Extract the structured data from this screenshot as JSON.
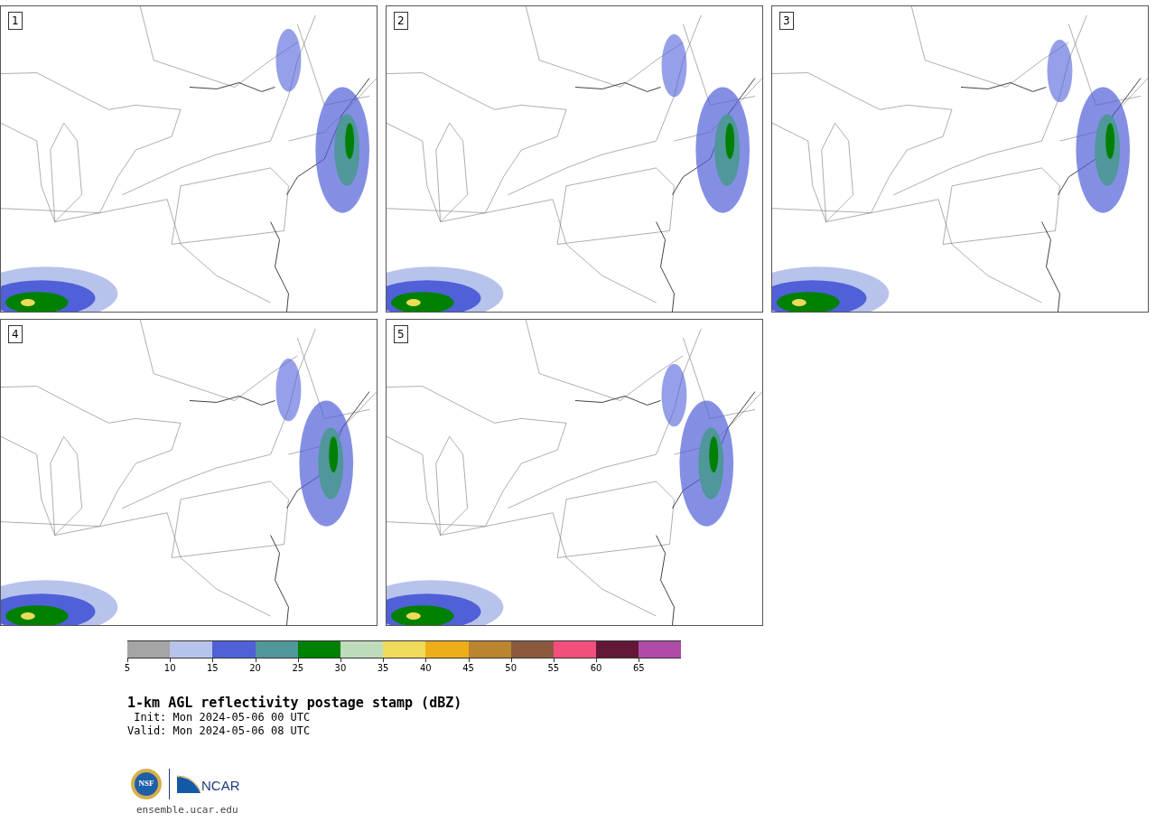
{
  "panels": [
    {
      "label": "1"
    },
    {
      "label": "2"
    },
    {
      "label": "3"
    },
    {
      "label": "4"
    },
    {
      "label": "5"
    }
  ],
  "colorbar": [
    {
      "color": "#a5a5a5",
      "tick": "5"
    },
    {
      "color": "#b8c3ec",
      "tick": "10"
    },
    {
      "color": "#5060d8",
      "tick": "15"
    },
    {
      "color": "#4f979a",
      "tick": "20"
    },
    {
      "color": "#008000",
      "tick": "25"
    },
    {
      "color": "#bedcbc",
      "tick": "30"
    },
    {
      "color": "#eedb5a",
      "tick": "35"
    },
    {
      "color": "#eeae18",
      "tick": "40"
    },
    {
      "color": "#bb842f",
      "tick": "45"
    },
    {
      "color": "#8b5a3e",
      "tick": "50"
    },
    {
      "color": "#f2507c",
      "tick": "55"
    },
    {
      "color": "#621836",
      "tick": "60"
    },
    {
      "color": "#ae4ca8",
      "tick": "65"
    }
  ],
  "title": "1-km AGL reflectivity postage stamp (dBZ)",
  "init": " Init: Mon 2024-05-06 00 UTC",
  "valid": "Valid: Mon 2024-05-06 08 UTC",
  "logo": {
    "nsf": "NSF",
    "ncar": "NCAR"
  },
  "site": "ensemble.ucar.edu"
}
